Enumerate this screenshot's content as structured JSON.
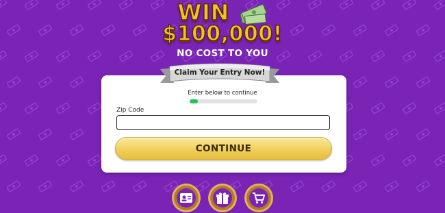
{
  "promo": {
    "win_word": "WIN",
    "amount": "$100,000!",
    "subtitle": "NO COST TO YOU"
  },
  "form": {
    "ribbon": "Claim Your Entry Now!",
    "prompt": "Enter below to continue",
    "progress_fraction": 0.12,
    "zip_label": "Zip Code",
    "zip_value": "",
    "continue_label": "CONTINUE"
  },
  "colors": {
    "background": "#7a24b6",
    "gold": "#f5c12a",
    "progress": "#25c255",
    "button": "#f1cf5b"
  },
  "badges": [
    {
      "icon": "id-card-icon"
    },
    {
      "icon": "gift-box-icon"
    },
    {
      "icon": "shopping-cart-icon"
    }
  ]
}
